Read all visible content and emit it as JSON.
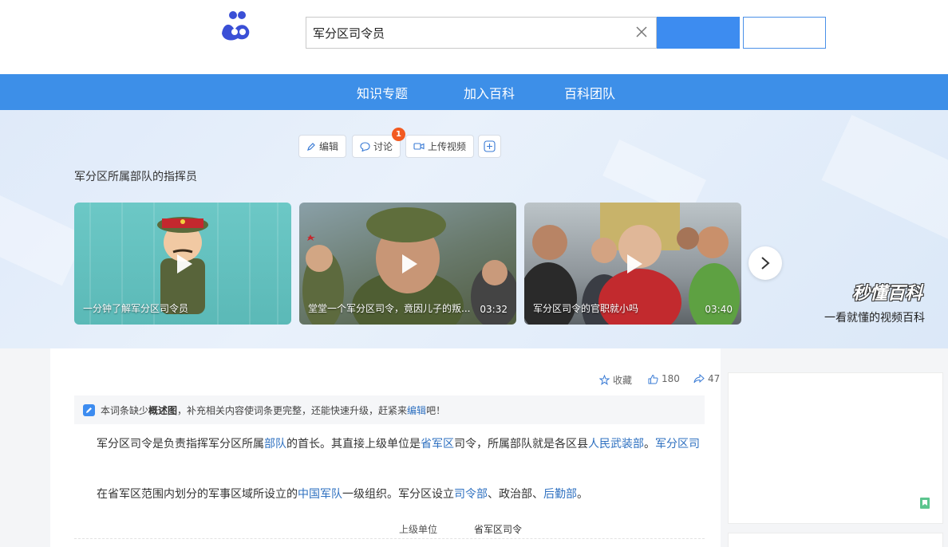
{
  "search": {
    "value": "军分区司令员"
  },
  "nav": {
    "items": [
      "知识专题",
      "加入百科",
      "百科团队"
    ]
  },
  "actions": {
    "edit": "编辑",
    "discuss": "讨论",
    "discuss_badge": "1",
    "upload_video": "上传视频"
  },
  "subtitle": "军分区所属部队的指挥员",
  "videos": [
    {
      "title": "一分钟了解军分区司令员",
      "duration": ""
    },
    {
      "title": "堂堂一个军分区司令，竟因儿子的叛...",
      "duration": "03:32"
    },
    {
      "title": "军分区司令的官职就小吗",
      "duration": "03:40"
    }
  ],
  "brand": {
    "logo": "秒懂百科",
    "slogan": "一看就懂的视频百科"
  },
  "meta": {
    "collect": "收藏",
    "likes": "180",
    "shares": "47"
  },
  "notice": {
    "prefix": "本词条缺少",
    "emphasis": "概述图",
    "middle": "，补充相关内容使词条更完整，还能快速升级，赶紧来",
    "link": "编辑",
    "suffix": "吧！"
  },
  "para1": {
    "t1": "军分区司令是负责指挥军分区所属",
    "l1": "部队",
    "t2": "的首长。其直接上级单位是",
    "l2": "省军区",
    "t3": "司令，所属部队就是各区县",
    "l3": "人民武装部",
    "t4": "。",
    "l4": "军分区司"
  },
  "para2": {
    "t1": "在省军区范围内划分的军事区域所设立的",
    "l1": "中国军队",
    "t2": "一级组织。军分区设立",
    "l2": "司令部",
    "t3": "、政治部、",
    "l3": "后勤部",
    "t4": "。"
  },
  "infobox": {
    "label1": "上级单位",
    "value1": "省军区司令"
  }
}
